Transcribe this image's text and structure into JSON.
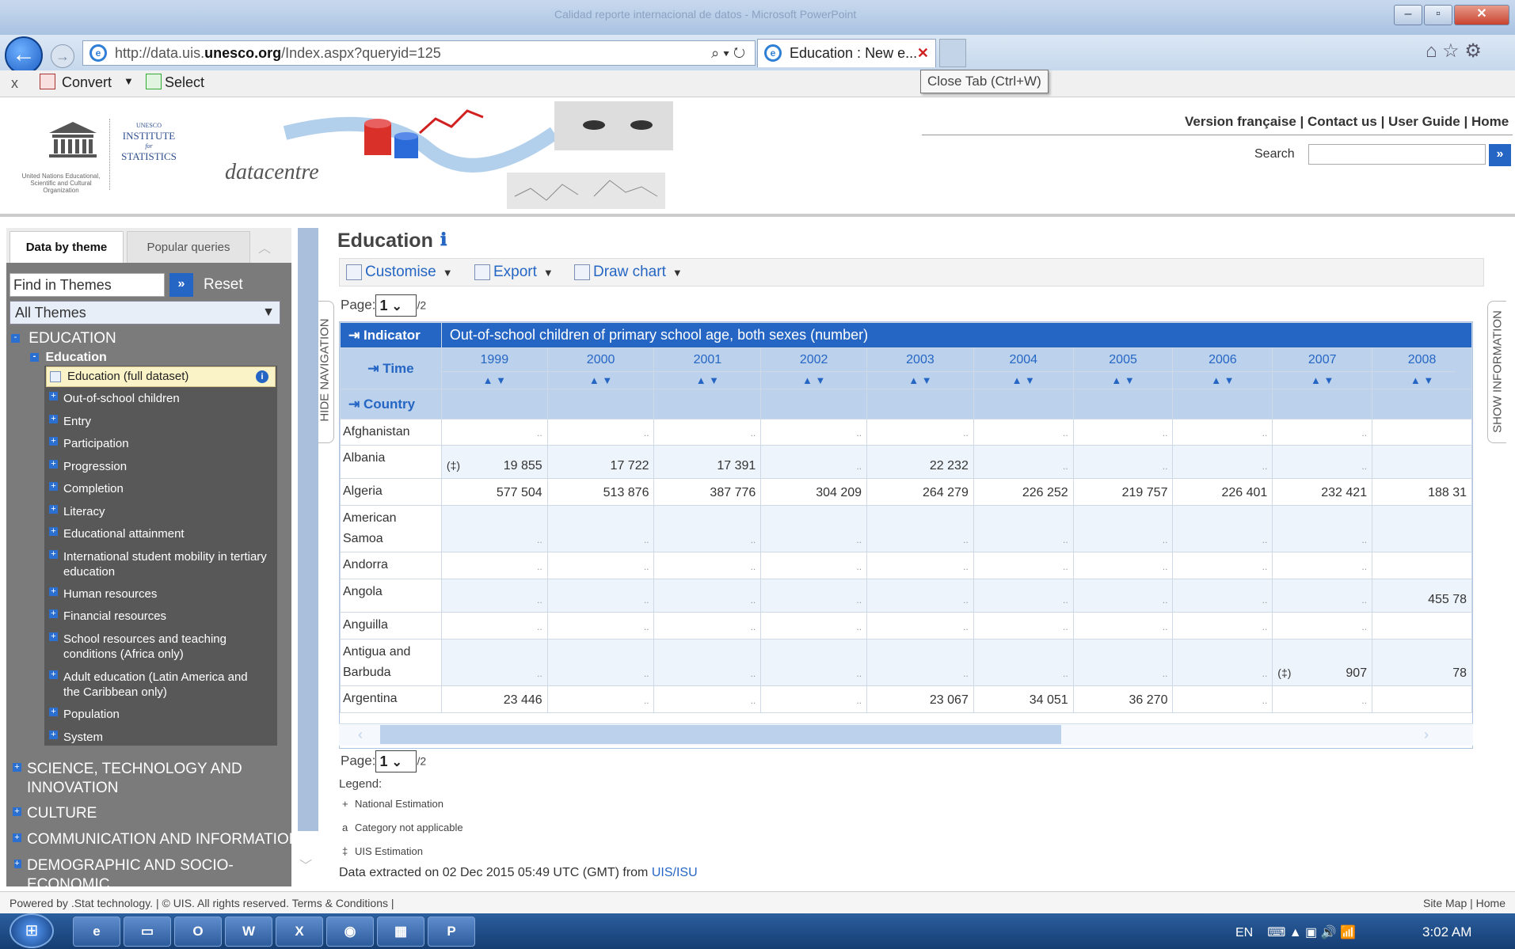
{
  "window": {
    "title": "Calidad reporte internacional de datos - Microsoft PowerPoint"
  },
  "browser": {
    "url_prefix": "http://data.uis.",
    "url_domain": "unesco.org",
    "url_suffix": "/Index.aspx?queryid=125",
    "tab_title": "Education : New e...",
    "tooltip": "Close Tab (Ctrl+W)",
    "cmd_close": "x",
    "cmd_convert": "Convert",
    "cmd_select": "Select"
  },
  "header": {
    "logo_top": "UNESCO",
    "logo_institute": "INSTITUTE",
    "logo_for": "for",
    "logo_stats": "STATISTICS",
    "logo_un": "United Nations Educational, Scientific and Cultural Organization",
    "brand": "datacentre",
    "links": "Version française | Contact us | User Guide | Home",
    "search_label": "Search",
    "search_go": "»"
  },
  "sidebar": {
    "tab_theme": "Data by theme",
    "tab_popular": "Popular queries",
    "find_placeholder": "Find in Themes",
    "find_go": "»",
    "reset": "Reset",
    "all_themes": "All Themes",
    "top_category": "EDUCATION",
    "sub_category": "Education",
    "selected_item": "Education (full dataset)",
    "items": [
      {
        "label": "Out-of-school children"
      },
      {
        "label": "Entry"
      },
      {
        "label": "Participation"
      },
      {
        "label": "Progression"
      },
      {
        "label": "Completion"
      },
      {
        "label": "Literacy"
      },
      {
        "label": "Educational attainment"
      },
      {
        "label": "International student mobility in tertiary education"
      },
      {
        "label": "Human resources"
      },
      {
        "label": "Financial resources"
      },
      {
        "label": "School resources and teaching conditions (Africa only)"
      },
      {
        "label": "Adult education (Latin America and the Caribbean only)"
      },
      {
        "label": "Population"
      },
      {
        "label": "System"
      }
    ],
    "categories": [
      {
        "label": "SCIENCE, TECHNOLOGY AND INNOVATION"
      },
      {
        "label": "CULTURE"
      },
      {
        "label": "COMMUNICATION AND INFORMATION"
      },
      {
        "label": "DEMOGRAPHIC AND SOCIO-ECONOMIC"
      }
    ],
    "hide_nav": "HIDE NAVIGATION"
  },
  "main": {
    "title": "Education",
    "toolbar": {
      "customise": "Customise",
      "export": "Export",
      "draw_chart": "Draw chart"
    },
    "page_label": "Page:",
    "page_value": "1",
    "page_of": "/2",
    "show_info": "SHOW INFORMATION"
  },
  "table": {
    "indicator_label": "Indicator",
    "indicator_value": "Out-of-school children of primary school age, both sexes (number)",
    "time_label": "Time",
    "country_label": "Country",
    "years": [
      "1999",
      "2000",
      "2001",
      "2002",
      "2003",
      "2004",
      "2005",
      "2006",
      "2007",
      "2008"
    ],
    "rows": [
      {
        "country": "Afghanistan",
        "values": [
          "..",
          "..",
          "..",
          "..",
          "..",
          "..",
          "..",
          "..",
          "..",
          " "
        ]
      },
      {
        "country": "Albania",
        "flag": "(‡)",
        "values": [
          "19 855",
          "17 722",
          "17 391",
          "..",
          "22 232",
          "..",
          "..",
          "..",
          "..",
          " "
        ]
      },
      {
        "country": "Algeria",
        "values": [
          "577 504",
          "513 876",
          "387 776",
          "304 209",
          "264 279",
          "226 252",
          "219 757",
          "226 401",
          "232 421",
          "188 31"
        ]
      },
      {
        "country": "American Samoa",
        "values": [
          "..",
          "..",
          "..",
          "..",
          "..",
          "..",
          "..",
          "..",
          "..",
          " "
        ]
      },
      {
        "country": "Andorra",
        "values": [
          "..",
          "..",
          "..",
          "..",
          "..",
          "..",
          "..",
          "..",
          "..",
          " "
        ]
      },
      {
        "country": "Angola",
        "values": [
          "..",
          "..",
          "..",
          "..",
          "..",
          "..",
          "..",
          "..",
          "..",
          "455 78"
        ]
      },
      {
        "country": "Anguilla",
        "values": [
          "..",
          "..",
          "..",
          "..",
          "..",
          "..",
          "..",
          "..",
          "..",
          " "
        ]
      },
      {
        "country": "Antigua and Barbuda",
        "flag9": "(‡)",
        "values": [
          "..",
          "..",
          "..",
          "..",
          "..",
          "..",
          "..",
          "..",
          "907",
          "78"
        ]
      },
      {
        "country": "Argentina",
        "values": [
          "23 446",
          "..",
          "..",
          "..",
          "23 067",
          "34 051",
          "36 270",
          "..",
          "..",
          " "
        ]
      }
    ]
  },
  "legend": {
    "title": "Legend:",
    "items": [
      {
        "sym": "+",
        "label": "National Estimation"
      },
      {
        "sym": "a",
        "label": "Category not applicable"
      },
      {
        "sym": "‡",
        "label": "UIS Estimation"
      }
    ],
    "extract_prefix": "Data extracted on 02 Dec 2015 05:49 UTC (GMT) from ",
    "extract_link": "UIS/ISU"
  },
  "footer": {
    "left": "Powered by .Stat technology. | © UIS. All rights reserved. Terms & Conditions  |",
    "right": "Site Map  | Home"
  },
  "taskbar": {
    "lang": "EN",
    "time": "3:02 AM",
    "apps": [
      {
        "icon": "ie-icon",
        "label": "e"
      },
      {
        "icon": "folder-icon",
        "label": "▭"
      },
      {
        "icon": "outlook-icon",
        "label": "O"
      },
      {
        "icon": "word-icon",
        "label": "W"
      },
      {
        "icon": "excel-icon",
        "label": "X"
      },
      {
        "icon": "chrome-icon",
        "label": "◉"
      },
      {
        "icon": "app-icon",
        "label": "▦"
      },
      {
        "icon": "powerpoint-icon",
        "label": "P"
      }
    ]
  }
}
